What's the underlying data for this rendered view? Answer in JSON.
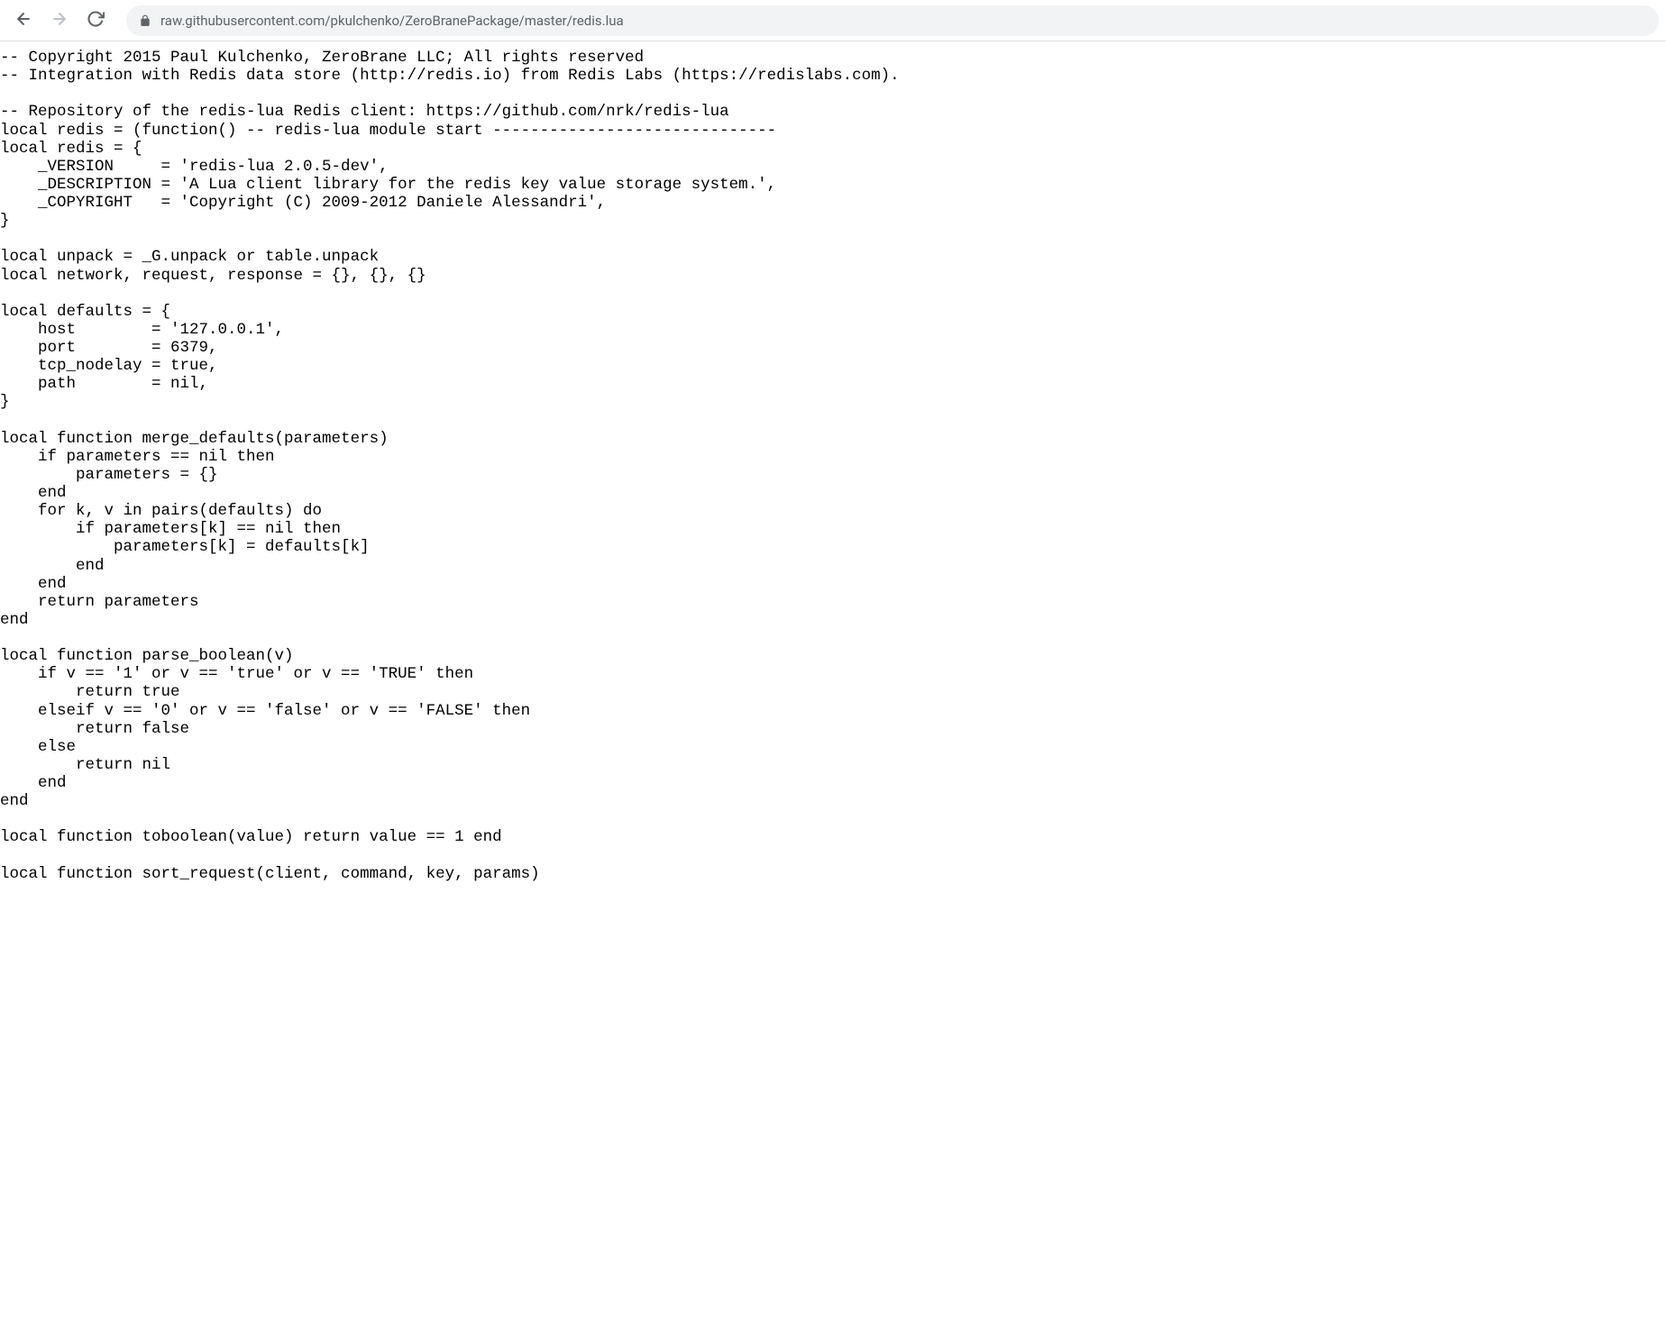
{
  "browser": {
    "url": "raw.githubusercontent.com/pkulchenko/ZeroBranePackage/master/redis.lua"
  },
  "code": "-- Copyright 2015 Paul Kulchenko, ZeroBrane LLC; All rights reserved\n-- Integration with Redis data store (http://redis.io) from Redis Labs (https://redislabs.com).\n\n-- Repository of the redis-lua Redis client: https://github.com/nrk/redis-lua\nlocal redis = (function() -- redis-lua module start ------------------------------\nlocal redis = {\n    _VERSION     = 'redis-lua 2.0.5-dev',\n    _DESCRIPTION = 'A Lua client library for the redis key value storage system.',\n    _COPYRIGHT   = 'Copyright (C) 2009-2012 Daniele Alessandri',\n}\n\nlocal unpack = _G.unpack or table.unpack\nlocal network, request, response = {}, {}, {}\n\nlocal defaults = {\n    host        = '127.0.0.1',\n    port        = 6379,\n    tcp_nodelay = true,\n    path        = nil,\n}\n\nlocal function merge_defaults(parameters)\n    if parameters == nil then\n        parameters = {}\n    end\n    for k, v in pairs(defaults) do\n        if parameters[k] == nil then\n            parameters[k] = defaults[k]\n        end\n    end\n    return parameters\nend\n\nlocal function parse_boolean(v)\n    if v == '1' or v == 'true' or v == 'TRUE' then\n        return true\n    elseif v == '0' or v == 'false' or v == 'FALSE' then\n        return false\n    else\n        return nil\n    end\nend\n\nlocal function toboolean(value) return value == 1 end\n\nlocal function sort_request(client, command, key, params)"
}
